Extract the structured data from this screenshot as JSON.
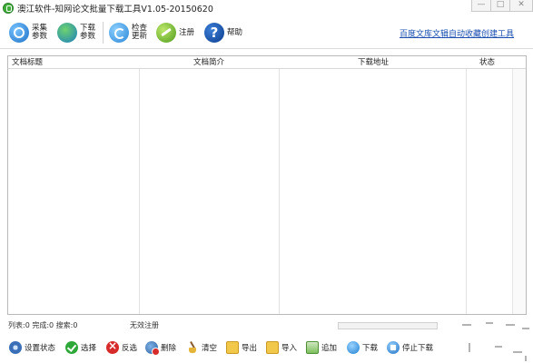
{
  "window": {
    "title": "澳江软件-知网论文批量下载工具V1.05-20150620",
    "minimize_symbol": "—",
    "maximize_symbol": "□",
    "close_symbol": "✕"
  },
  "toolbar": {
    "caiji_label": "采集\n参数",
    "xiazai_label": "下载\n参数",
    "jiansuo_label": "检查\n更新",
    "zhuce_label": "注册",
    "bangzhu_label": "帮助",
    "bangzhu_glyph": "?",
    "link_text": "百度文库文辑自动收藏创建工具"
  },
  "table": {
    "columns": [
      "文档标题",
      "文档简介",
      "下载地址",
      "状态"
    ],
    "rows": []
  },
  "status": {
    "counts": "列表:0  完成:0  搜索:0",
    "registration": "无效注册",
    "progress_percent": 0
  },
  "actions": {
    "settings_label": "设置状态",
    "select_label": "选择",
    "invert_label": "反选",
    "delete_label": "删除",
    "clear_label": "清空",
    "export_label": "导出",
    "import_label": "导入",
    "add_label": "追加",
    "download_label": "下载",
    "stop_label": "停止下载"
  },
  "colors": {
    "link": "#1a4fb0",
    "accent_green": "#3fae3b",
    "accent_blue": "#1f6fc1"
  }
}
